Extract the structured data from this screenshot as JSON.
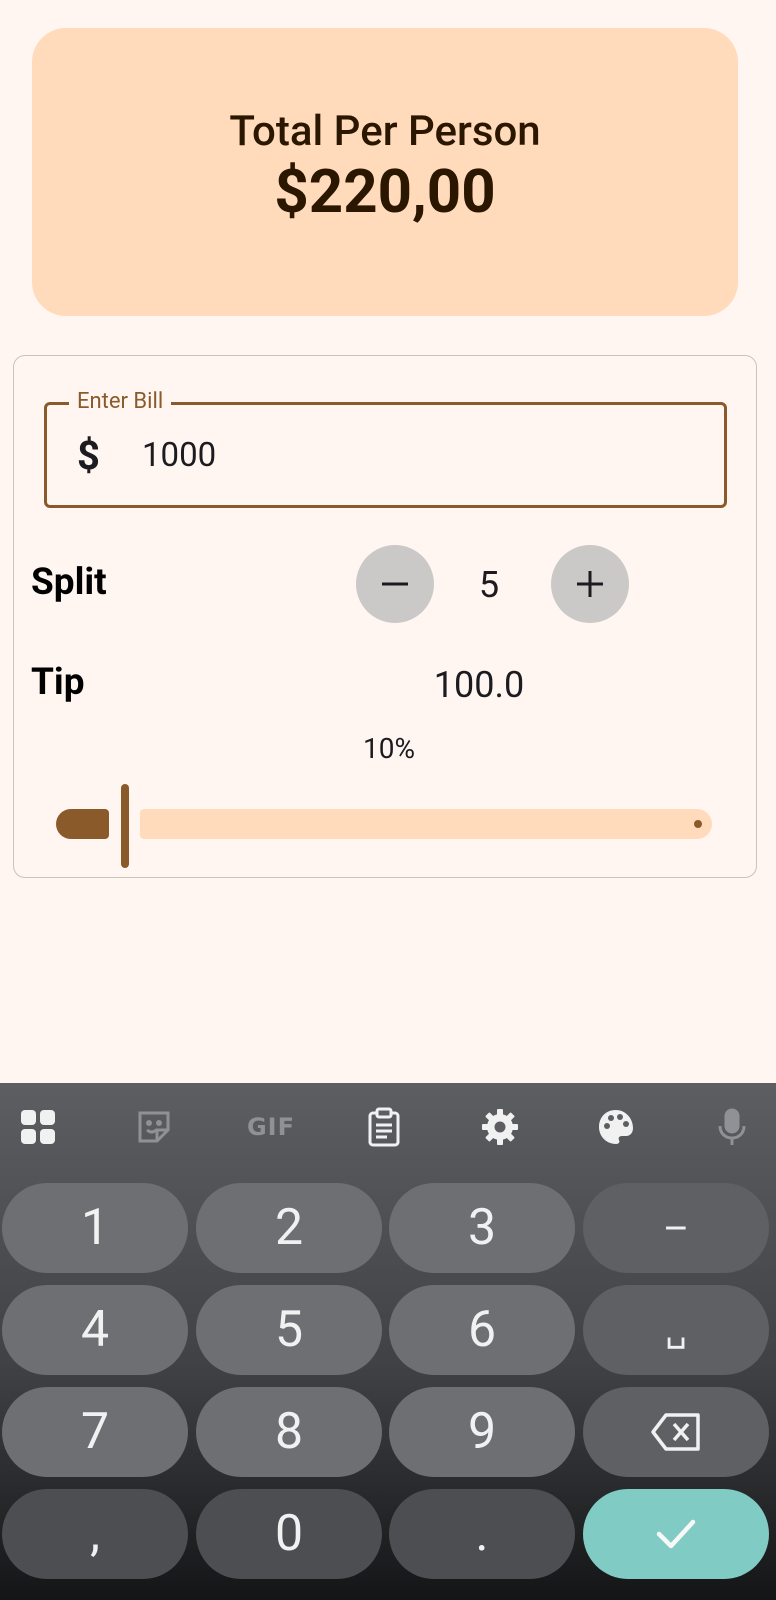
{
  "total": {
    "label": "Total Per Person",
    "value": "$220,00"
  },
  "bill": {
    "legend": "Enter Bill",
    "prefix": "$",
    "value": "1000"
  },
  "split": {
    "label": "Split",
    "count": "5"
  },
  "tip": {
    "label": "Tip",
    "amount": "100.0",
    "percent_label": "10%",
    "slider_value": 0.1
  },
  "colors": {
    "accent": "#8b5a2b",
    "card": "#ffdbbb",
    "background": "#fff6f2",
    "confirm_key": "#80cbc4"
  },
  "keyboard": {
    "toolbar_icons": [
      "apps-grid-icon",
      "sticker-icon",
      "gif-icon",
      "clipboard-icon",
      "settings-icon",
      "palette-icon",
      "microphone-icon"
    ],
    "gif_label": "GIF",
    "keys": {
      "k1": "1",
      "k2": "2",
      "k3": "3",
      "dash": "–",
      "k4": "4",
      "k5": "5",
      "k6": "6",
      "space": "␣",
      "k7": "7",
      "k8": "8",
      "k9": "9",
      "comma": ",",
      "k0": "0",
      "period": "."
    }
  }
}
